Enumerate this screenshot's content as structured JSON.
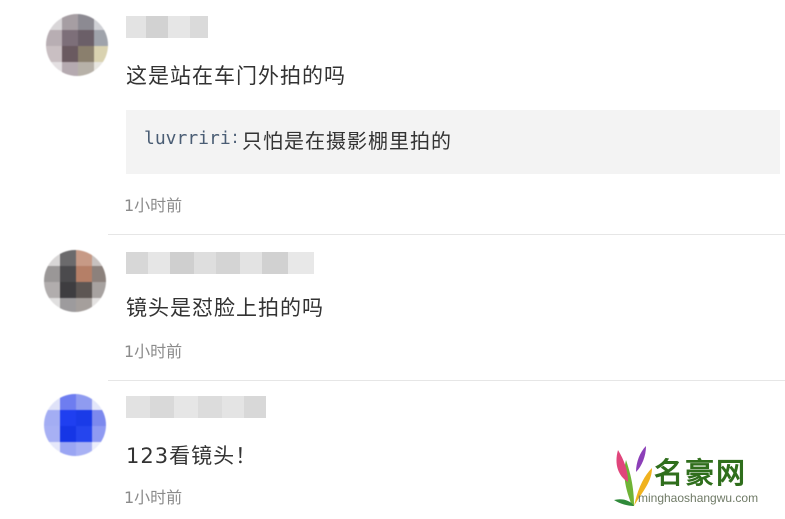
{
  "comments": [
    {
      "text": "这是站在车门外拍的吗",
      "reply": {
        "user": "luvrriri",
        "colon": ":",
        "text": "只怕是在摄影棚里拍的"
      },
      "time": "1小时前"
    },
    {
      "text": "镜头是怼脸上拍的吗",
      "time": "1小时前"
    },
    {
      "text": "123看镜头！",
      "time": "1小时前"
    }
  ],
  "watermark": {
    "brand": "名豪网",
    "url": "minghaoshangwu.com",
    "colors": {
      "green": "#2f6e1c",
      "pink": "#e0457b",
      "yellow": "#f0b21e"
    }
  },
  "colors": {
    "text": "#333333",
    "reply_user": "#4a5d74",
    "reply_bg": "#f3f3f3",
    "timestamp": "#8b8b8b",
    "divider": "#e6e6e6"
  }
}
